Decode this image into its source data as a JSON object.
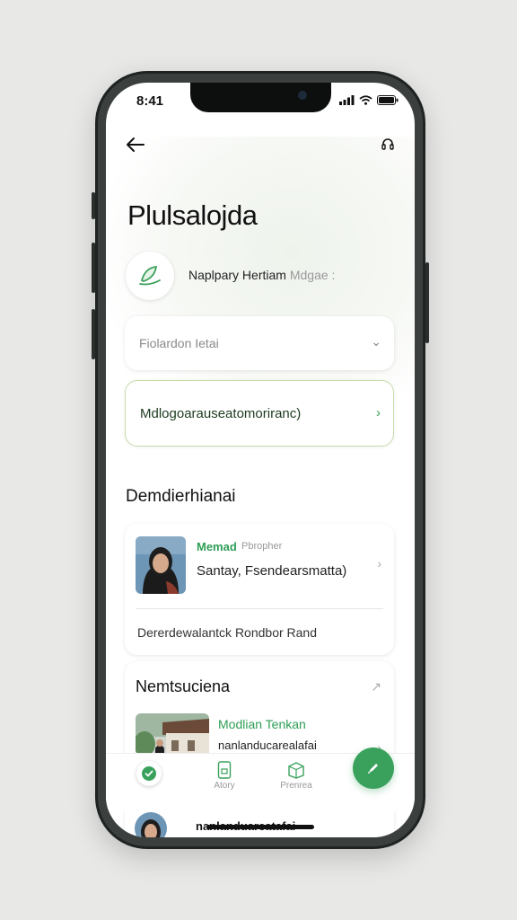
{
  "status_bar": {
    "time": "8:41"
  },
  "header": {
    "title": "Plulsalojda"
  },
  "brand": {
    "name": "Naplpary Hertiam",
    "muted": "Mdgae :"
  },
  "dropdown": {
    "label": "Fiolardon Ietai"
  },
  "selected_field": {
    "label": "Mdlogoarauseatomoriranc)"
  },
  "section1": {
    "title": "Demdierhianai"
  },
  "profile_card": {
    "name": "Memad",
    "role": "Pbropher",
    "desc": "Santay, Fsendearsmatta)",
    "footer": "Dererdewalantck Rondbor Rand"
  },
  "card2": {
    "title": "Nemtsuciena",
    "item_title": "Modlian Tenkan",
    "item_desc": "nanlanducarealafai"
  },
  "tabbar": {
    "tabs": [
      {
        "label": "Atory",
        "icon": "phone-icon"
      },
      {
        "label": "Prenrea",
        "icon": "cube-icon"
      }
    ]
  },
  "bottom": {
    "text": "nanlanduareatafai"
  },
  "colors": {
    "accent": "#3aa15c",
    "accent_border": "#c7dcaa"
  }
}
